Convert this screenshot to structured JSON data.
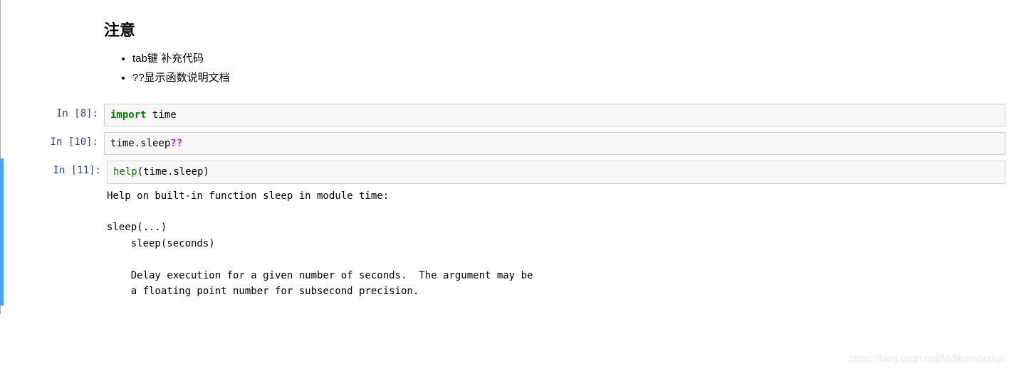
{
  "markdown": {
    "heading": "注意",
    "bullets": [
      "tab键 补充代码",
      "??显示函数说明文档"
    ]
  },
  "cells": [
    {
      "prompt_label": "In ",
      "prompt_num": "[8]:",
      "code_tokens": [
        {
          "text": "import",
          "cls": "kw-import"
        },
        {
          "text": " time",
          "cls": ""
        }
      ]
    },
    {
      "prompt_label": "In ",
      "prompt_num": "[10]:",
      "code_tokens": [
        {
          "text": "time.sleep",
          "cls": ""
        },
        {
          "text": "??",
          "cls": "kw-magic"
        }
      ]
    },
    {
      "prompt_label": "In ",
      "prompt_num": "[11]:",
      "code_tokens": [
        {
          "text": "help",
          "cls": "kw-builtin"
        },
        {
          "text": "(time.sleep)",
          "cls": ""
        }
      ],
      "output": "Help on built-in function sleep in module time:\n\nsleep(...)\n    sleep(seconds)\n    \n    Delay execution for a given number of seconds.  The argument may be\n    a floating point number for subsecond precision.\n"
    }
  ],
  "watermark": "https://blog.csdn.net/MiStonebridge"
}
